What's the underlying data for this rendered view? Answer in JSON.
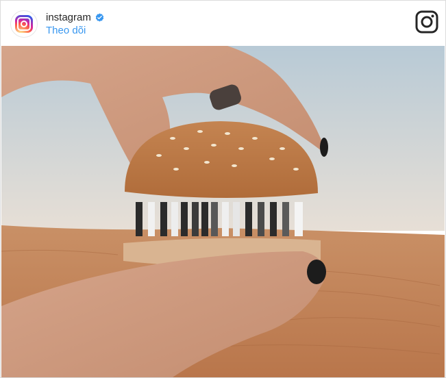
{
  "post": {
    "account": {
      "username": "instagram",
      "verified": true
    },
    "follow_label": "Theo dõi",
    "logo": "instagram-glyph-icon",
    "image": {
      "description_icon": "desert-burger-photo"
    }
  },
  "colors": {
    "follow_link": "#3897f0",
    "verified_badge": "#3897f0",
    "sand": "#c88a5c",
    "sky": "#c9d6e0"
  }
}
